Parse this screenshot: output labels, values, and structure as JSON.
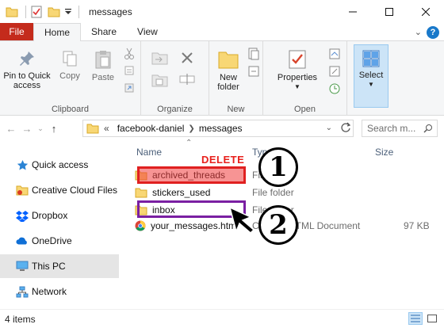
{
  "window": {
    "title": "messages",
    "quick_access_icons": [
      "folder-icon",
      "properties-check-icon",
      "new-folder-icon",
      "customize-arrow-icon"
    ]
  },
  "ribbon": {
    "tabs": [
      {
        "label": "File"
      },
      {
        "label": "Home",
        "active": true
      },
      {
        "label": "Share"
      },
      {
        "label": "View"
      }
    ],
    "buttons": {
      "pin": "Pin to Quick\naccess",
      "copy": "Copy",
      "paste": "Paste",
      "new_folder": "New\nfolder",
      "properties": "Properties",
      "select": "Select"
    },
    "groups": {
      "clipboard": "Clipboard",
      "organize": "Organize",
      "new": "New",
      "open": "Open"
    }
  },
  "address": {
    "overflow": "«",
    "crumbs": [
      "facebook-daniel",
      "messages"
    ],
    "search_placeholder": "Search m..."
  },
  "nav_pane": {
    "items": [
      {
        "label": "Quick access",
        "icon": "star-icon"
      },
      {
        "label": "Creative Cloud Files",
        "icon": "creative-cloud-icon"
      },
      {
        "label": "Dropbox",
        "icon": "dropbox-icon"
      },
      {
        "label": "OneDrive",
        "icon": "onedrive-cloud-icon"
      },
      {
        "label": "This PC",
        "icon": "computer-icon",
        "selected": true
      },
      {
        "label": "Network",
        "icon": "network-icon"
      }
    ]
  },
  "file_list": {
    "columns": {
      "name": "Name",
      "type": "Type",
      "size": "Size"
    },
    "rows": [
      {
        "name": "archived_threads",
        "type": "File folder",
        "size": "",
        "icon": "folder-icon"
      },
      {
        "name": "stickers_used",
        "type": "File folder",
        "size": "",
        "icon": "folder-icon"
      },
      {
        "name": "inbox",
        "type": "File folder",
        "size": "",
        "icon": "folder-icon"
      },
      {
        "name": "your_messages.html",
        "type": "Chrome HTML Document",
        "size": "97 KB",
        "icon": "chrome-icon"
      }
    ]
  },
  "annotations": {
    "delete_label": "DELETE",
    "step1": "1",
    "step2": "2",
    "delete_color": "#e8201c",
    "highlight_purple": "#7a1fa2"
  },
  "status": {
    "item_count": "4 items"
  },
  "colors": {
    "file_tab": "#c42b1c",
    "select_bg": "#cce4f7",
    "folder": "#f8d775"
  }
}
